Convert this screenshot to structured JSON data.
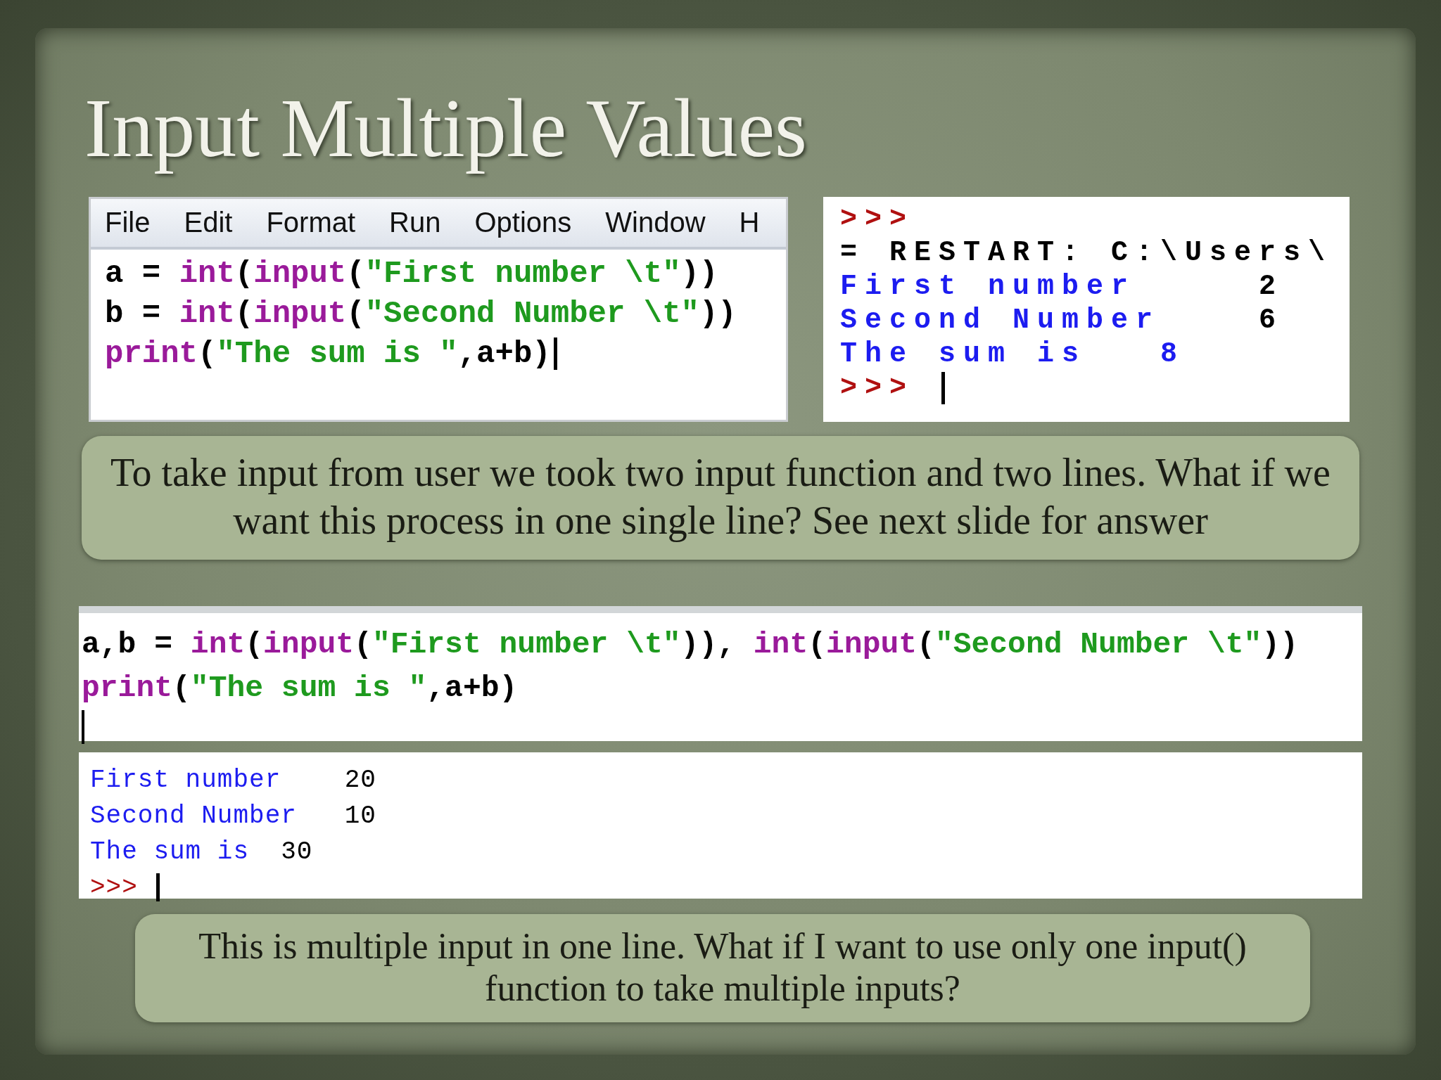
{
  "title": "Input Multiple Values",
  "editor": {
    "menu": [
      "File",
      "Edit",
      "Format",
      "Run",
      "Options",
      "Window",
      "H"
    ],
    "lines": [
      [
        {
          "kind": "plain",
          "text": "a = "
        },
        {
          "kind": "builtin",
          "text": "int"
        },
        {
          "kind": "plain",
          "text": "("
        },
        {
          "kind": "builtin",
          "text": "input"
        },
        {
          "kind": "plain",
          "text": "("
        },
        {
          "kind": "string",
          "text": "\"First number \\t\""
        },
        {
          "kind": "plain",
          "text": "))"
        }
      ],
      [
        {
          "kind": "plain",
          "text": "b = "
        },
        {
          "kind": "builtin",
          "text": "int"
        },
        {
          "kind": "plain",
          "text": "("
        },
        {
          "kind": "builtin",
          "text": "input"
        },
        {
          "kind": "plain",
          "text": "("
        },
        {
          "kind": "string",
          "text": "\"Second Number \\t\""
        },
        {
          "kind": "plain",
          "text": "))"
        }
      ],
      [
        {
          "kind": "builtin",
          "text": "print"
        },
        {
          "kind": "plain",
          "text": "("
        },
        {
          "kind": "string",
          "text": "\"The sum is \""
        },
        {
          "kind": "plain",
          "text": ",a+b)"
        }
      ]
    ]
  },
  "shell": {
    "lines": [
      [
        {
          "kind": "prompt",
          "text": ">>> "
        }
      ],
      [
        {
          "kind": "plain",
          "text": "= RESTART: C:\\Users\\"
        }
      ],
      [
        {
          "kind": "output",
          "text": "First number     "
        },
        {
          "kind": "plain",
          "text": "2"
        }
      ],
      [
        {
          "kind": "output",
          "text": "Second Number    "
        },
        {
          "kind": "plain",
          "text": "6"
        }
      ],
      [
        {
          "kind": "output",
          "text": "The sum is   "
        },
        {
          "kind": "output",
          "text": "8"
        }
      ],
      [
        {
          "kind": "prompt",
          "text": ">>> "
        }
      ]
    ]
  },
  "note_1": "To take input from user  we took two input function and two lines. What if we want this process in one single line? See next slide for answer",
  "code": {
    "lines": [
      [
        {
          "kind": "plain",
          "text": "a,b = "
        },
        {
          "kind": "builtin",
          "text": "int"
        },
        {
          "kind": "plain",
          "text": "("
        },
        {
          "kind": "builtin",
          "text": "input"
        },
        {
          "kind": "plain",
          "text": "("
        },
        {
          "kind": "string",
          "text": "\"First number \\t\""
        },
        {
          "kind": "plain",
          "text": ")), "
        },
        {
          "kind": "builtin",
          "text": "int"
        },
        {
          "kind": "plain",
          "text": "("
        },
        {
          "kind": "builtin",
          "text": "input"
        },
        {
          "kind": "plain",
          "text": "("
        },
        {
          "kind": "string",
          "text": "\"Second Number \\t\""
        },
        {
          "kind": "plain",
          "text": "))"
        }
      ],
      [
        {
          "kind": "builtin",
          "text": "print"
        },
        {
          "kind": "plain",
          "text": "("
        },
        {
          "kind": "string",
          "text": "\"The sum is \""
        },
        {
          "kind": "plain",
          "text": ",a+b)"
        }
      ]
    ]
  },
  "output": {
    "lines": [
      [
        {
          "kind": "output",
          "text": "First number    "
        },
        {
          "kind": "plain",
          "text": "20"
        }
      ],
      [
        {
          "kind": "output",
          "text": "Second Number   "
        },
        {
          "kind": "plain",
          "text": "10"
        }
      ],
      [
        {
          "kind": "output",
          "text": "The sum is  "
        },
        {
          "kind": "plain",
          "text": "30"
        }
      ],
      [
        {
          "kind": "prompt",
          "text": ">>> "
        }
      ]
    ]
  },
  "note_2": "This is multiple input in one line. What if I want to use only one input() function to take multiple inputs?"
}
